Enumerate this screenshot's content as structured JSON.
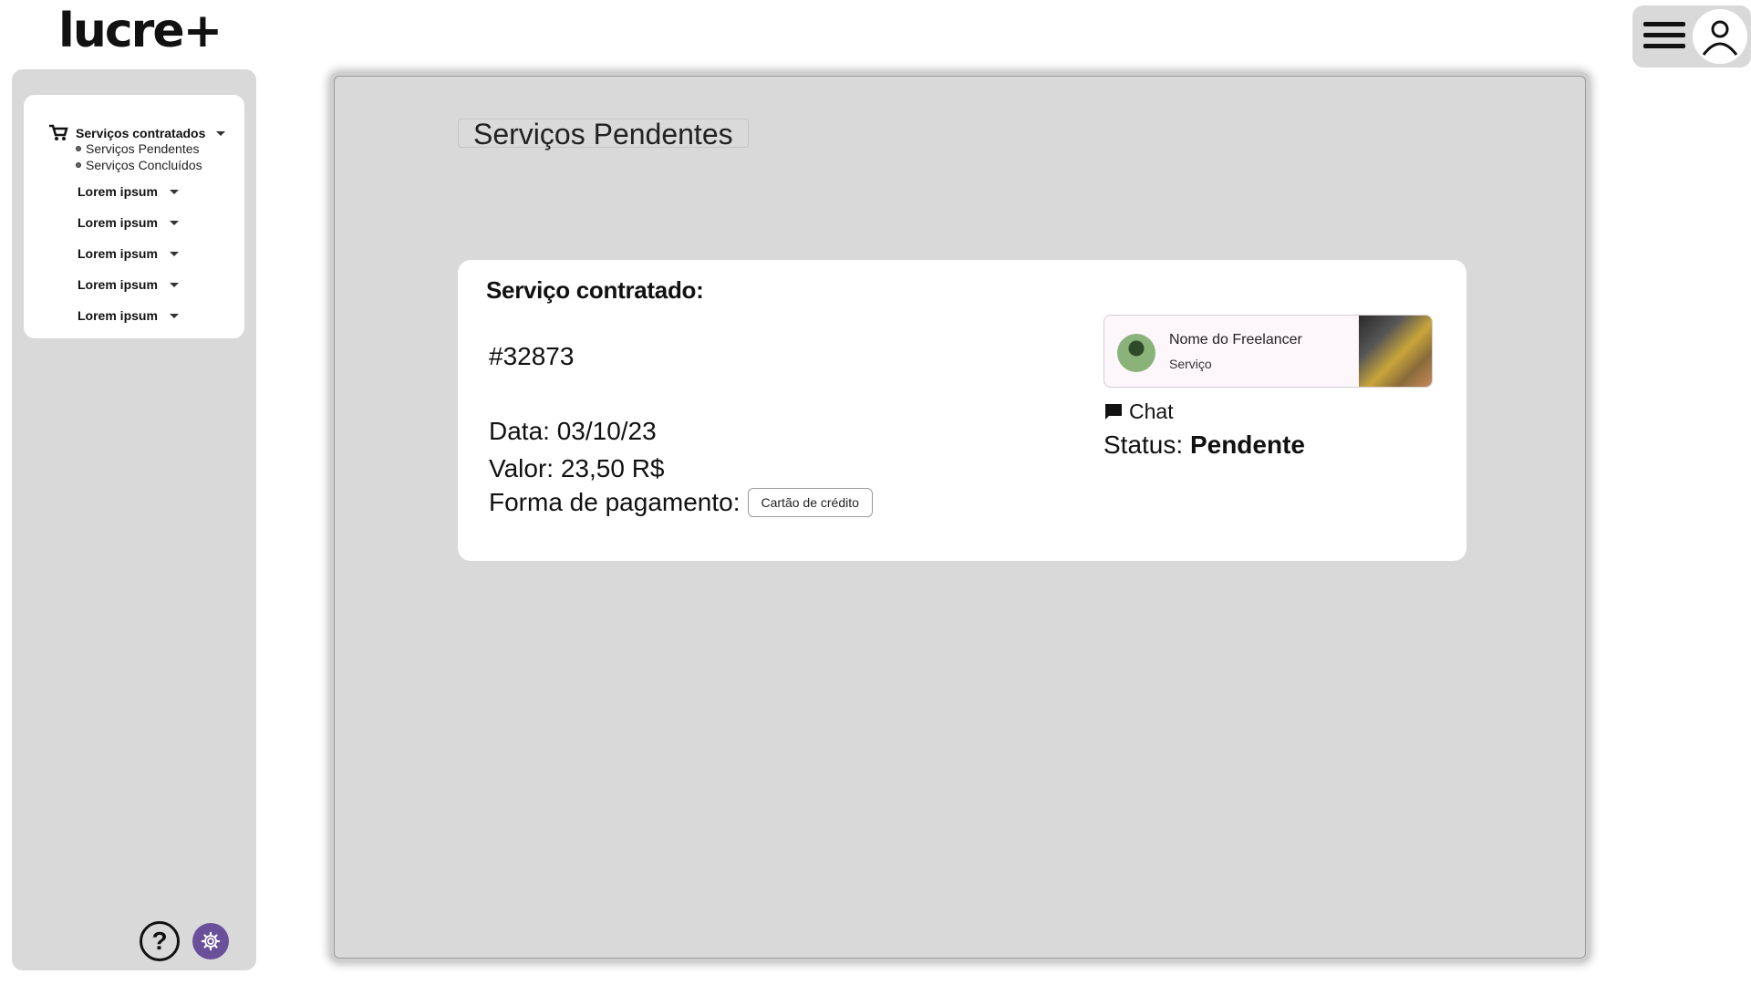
{
  "header": {
    "logo": "lucre+"
  },
  "sidebar": {
    "main_item": "Serviços contratados",
    "sub_items": [
      "Serviços Pendentes",
      "Serviços Concluídos"
    ],
    "items": [
      {
        "label": "Lorem ipsum"
      },
      {
        "label": "Lorem ipsum"
      },
      {
        "label": "Lorem ipsum"
      },
      {
        "label": "Lorem ipsum"
      },
      {
        "label": "Lorem ipsum"
      }
    ],
    "help_label": "?"
  },
  "main": {
    "page_title": "Serviços Pendentes",
    "card": {
      "title": "Serviço contratado:",
      "order_id": "#32873",
      "date": "Data: 03/10/23",
      "value": "Valor: 23,50 R$",
      "payment_label": "Forma de pagamento:",
      "payment_method": "Cartão de crédito",
      "freelancer": {
        "name": "Nome do Freelancer",
        "service": "Serviço"
      },
      "chat_label": "Chat",
      "status_label": "Status:",
      "status_value": "Pendente"
    }
  },
  "colors": {
    "panel": "#d9d9d9",
    "settings_button": "#6a4f9a"
  }
}
